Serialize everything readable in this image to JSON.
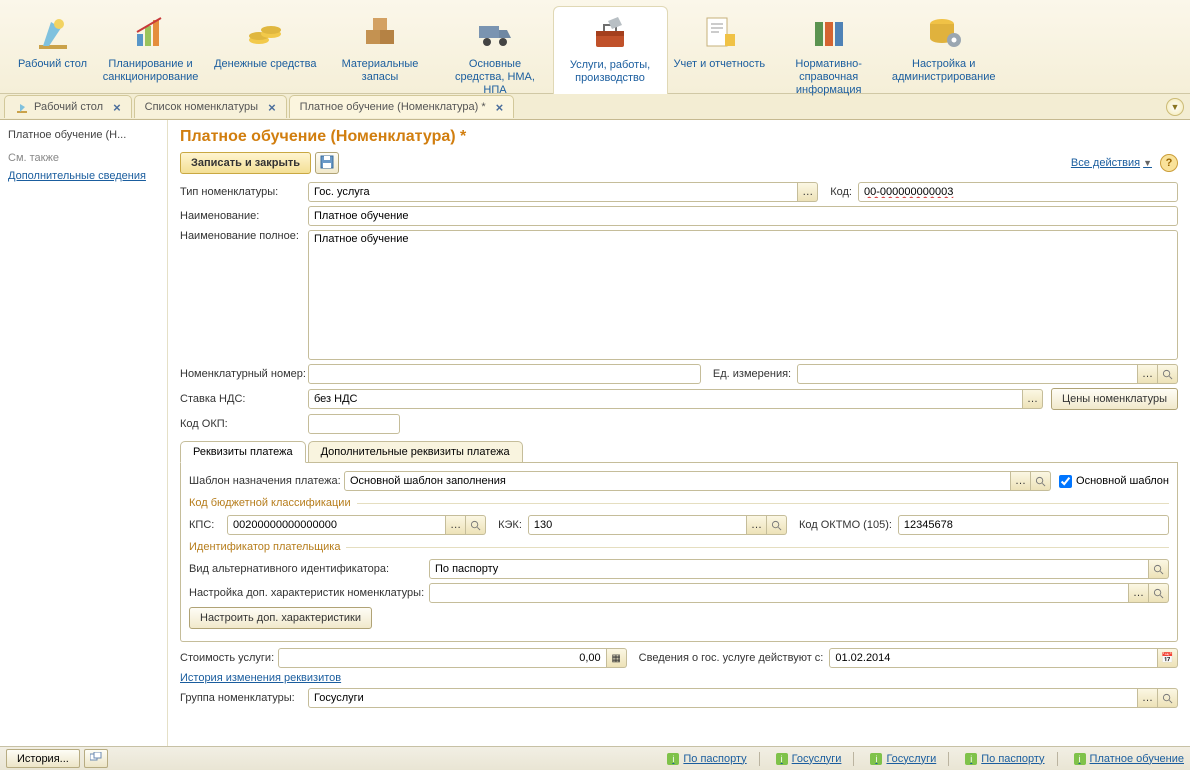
{
  "toolbarItems": [
    "Рабочий стол",
    "Планирование и санкционирование",
    "Денежные средства",
    "Материальные запасы",
    "Основные средства, НМА, НПА",
    "Услуги, работы, производство",
    "Учет и отчетность",
    "Нормативно-справочная информация",
    "Настройка и администрирование"
  ],
  "openTabs": {
    "t0": "Рабочий стол",
    "t1": "Список номенклатуры",
    "t2": "Платное обучение (Номенклатура) *"
  },
  "sidebar": {
    "title": "Платное обучение (Н...",
    "section": "См. также",
    "link0": "Дополнительные сведения"
  },
  "page": {
    "title": "Платное обучение (Номенклатура) *"
  },
  "actions": {
    "save": "Записать и закрыть",
    "allActions": "Все действия"
  },
  "labels": {
    "type": "Тип номенклатуры:",
    "name": "Наименование:",
    "fullName": "Наименование полное:",
    "nomNumber": "Номенклатурный номер:",
    "unit": "Ед. измерения:",
    "vat": "Ставка НДС:",
    "pricesBtn": "Цены номенклатуры",
    "okp": "Код ОКП:",
    "code": "Код:",
    "tabPayment": "Реквизиты платежа",
    "tabPaymentExtra": "Дополнительные реквизиты платежа",
    "template": "Шаблон назначения платежа:",
    "mainTemplate": "Основной шаблон",
    "kbkGroup": "Код бюджетной классификации",
    "kps": "КПС:",
    "kek": "КЭК:",
    "oktmo": "Код ОКТМО (105):",
    "payerIdGroup": "Идентификатор плательщика",
    "altId": "Вид альтернативного идентификатора:",
    "charSetup": "Настройка доп. характеристик номенклатуры:",
    "charBtn": "Настроить доп. характеристики",
    "cost": "Стоимость услуги:",
    "effectFrom": "Сведения о гос. услуге действуют с:",
    "history": "История изменения реквизитов",
    "nomGroup": "Группа номенклатуры:"
  },
  "values": {
    "type": "Гос. услуга",
    "code": "00-000000000003",
    "name": "Платное обучение",
    "fullName": "Платное обучение",
    "nomNumber": "",
    "unit": "",
    "vat": "без НДС",
    "okp": "",
    "template": "Основной шаблон заполнения",
    "kps": "00200000000000000",
    "kek": "130",
    "oktmo": "12345678",
    "altId": "По паспорту",
    "charSetup": "",
    "cost": "0,00",
    "effectFrom": "01.02.2014",
    "nomGroup": "Госуслуги"
  },
  "status": {
    "history": "История...",
    "items": [
      "По паспорту",
      "Госуслуги",
      "Госуслуги",
      "По паспорту",
      "Платное обучение"
    ]
  }
}
